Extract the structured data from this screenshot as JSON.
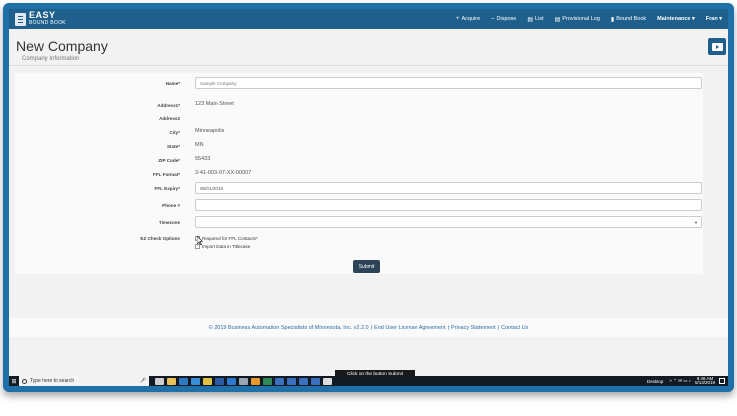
{
  "app": {
    "brand_top": "EASY",
    "brand_bottom": "BOUND BOOK"
  },
  "nav": {
    "items": [
      {
        "icon": "+",
        "label": "Acquire"
      },
      {
        "icon": "–",
        "label": "Dispose"
      },
      {
        "icon": "▤",
        "label": "List"
      },
      {
        "icon": "▤",
        "label": "Provisional Log"
      },
      {
        "icon": "▮",
        "label": "Bound Book"
      }
    ],
    "maintenance": "Maintenance ▾",
    "user": "Fran ▾"
  },
  "page": {
    "title": "New Company",
    "section": "Company Information"
  },
  "form": {
    "name_label": "Name*",
    "name_placeholder": "Sample Company",
    "address1_label": "Address1*",
    "address1_value": "123 Main Street",
    "address2_label": "Address2",
    "city_label": "City*",
    "city_value": "Minneapolis",
    "state_label": "State*",
    "state_value": "MN",
    "zip_label": "ZIP Code*",
    "zip_value": "55433",
    "ffl_format_label": "FFL Format*",
    "ffl_format_value": "3-41-003-07-XX-00007",
    "ffl_expiry_label": "FFL Expiry*",
    "ffl_expiry_value": "05/01/2019",
    "phone_label": "Phone #",
    "timezone_label": "Timezone",
    "ez_label": "EZ Check Options",
    "ez_opt1": "Required for FFL Contacts*",
    "ez_opt1_checked": true,
    "ez_opt2": "Import Data in Titlecase",
    "ez_opt2_checked": false,
    "submit": "Submit"
  },
  "footer": {
    "copyright": "© 2019 Business Automation Specialists of Minnesota, Inc. v2.2.0",
    "sep": "|",
    "eula": "End User License Agreement",
    "privacy": "Privacy Statement",
    "contact": "Contact Us"
  },
  "tooltip": "Click on the button Submit",
  "taskbar": {
    "search": "Type here to search",
    "desktop": "Desktop",
    "time": "9:46 AM",
    "date": "5/13/2019"
  },
  "colors": {
    "frame": "#1f6fa8",
    "navbar": "#1e5f8c",
    "submit": "#2d4458",
    "link": "#2e6da4"
  }
}
